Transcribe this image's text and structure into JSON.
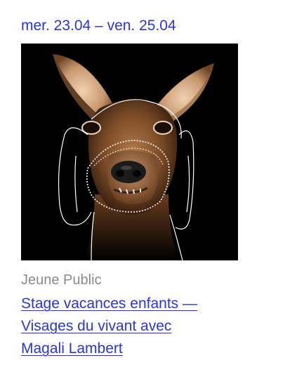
{
  "event": {
    "date_range": "mer. 23.04 – ven. 25.04",
    "image": {
      "alt": "",
      "background": "#000000"
    },
    "category": "Jeune Public",
    "title_lines": [
      "Stage vacances enfants —",
      "Visages du vivant avec",
      "Magali Lambert"
    ]
  },
  "colors": {
    "link": "#2a35d6",
    "category": "#8a8a8a",
    "background": "#ffffff"
  }
}
